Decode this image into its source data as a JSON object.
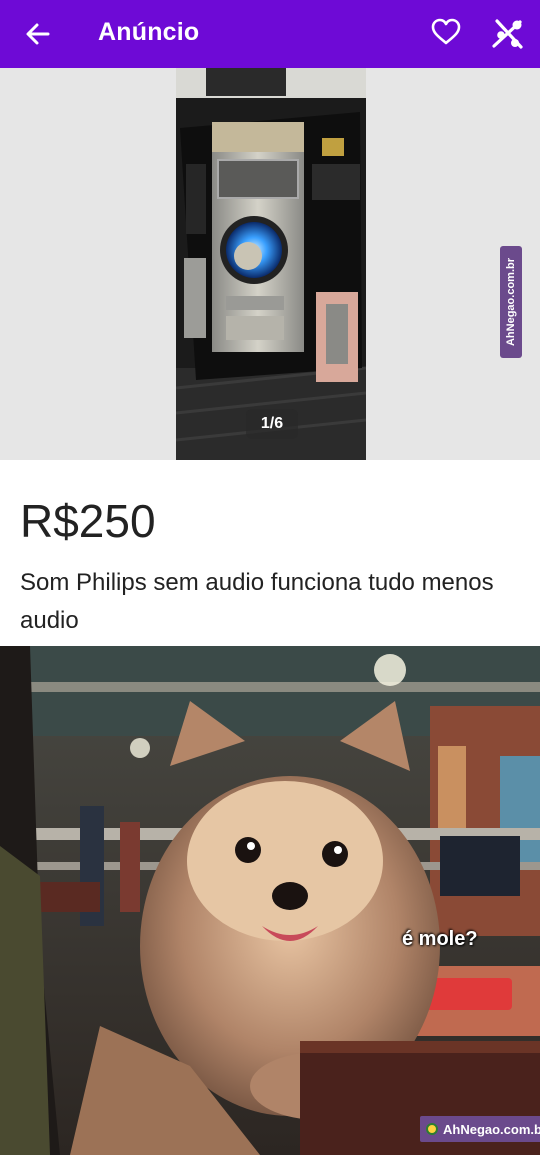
{
  "header": {
    "title": "Anúncio",
    "back_icon": "arrow-left-icon",
    "favorite_icon": "heart-outline-icon",
    "share_icon": "share-icon",
    "background": "#6e0ad6"
  },
  "gallery": {
    "counter": "1/6",
    "watermark": "AhNegao.com.br"
  },
  "ad": {
    "price": "R$250",
    "description": "Som Philips  sem audio funciona tudo menos audio"
  },
  "meme": {
    "caption": "é mole?",
    "watermark": "AhNegao.com.br"
  }
}
